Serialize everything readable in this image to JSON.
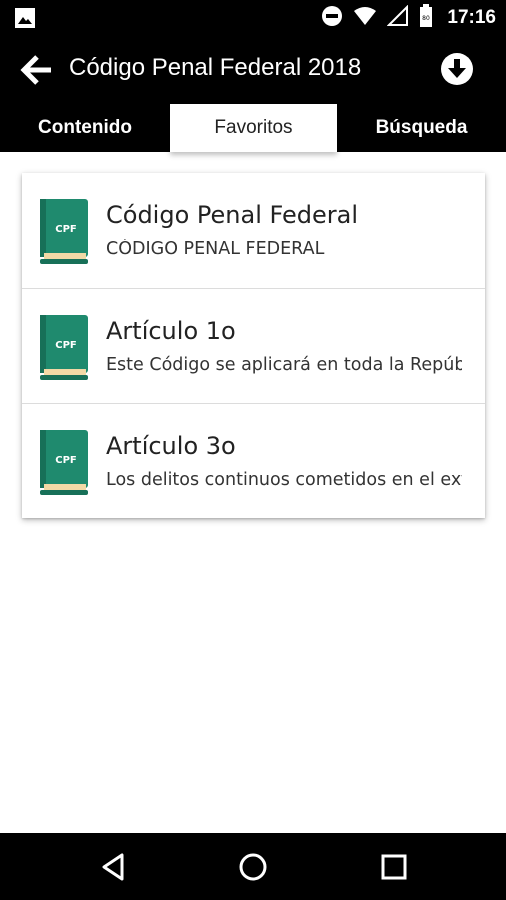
{
  "status_bar": {
    "time": "17:16",
    "icons": [
      "image-icon",
      "do-not-disturb-icon",
      "wifi-icon",
      "signal-icon",
      "battery-icon"
    ],
    "battery_label": "80"
  },
  "app_bar": {
    "title": "Código Penal Federal 2018",
    "back_icon": "arrow-left-icon",
    "download_icon": "download-circle-icon"
  },
  "tabs": [
    {
      "label": "Contenido",
      "active": false
    },
    {
      "label": "Favoritos",
      "active": true
    },
    {
      "label": "Búsqueda",
      "active": false
    }
  ],
  "favorites": [
    {
      "title": "Código Penal Federal",
      "subtitle": "CÓDIGO PENAL FEDERAL",
      "book_label": "CPF"
    },
    {
      "title": "Artículo 1o",
      "subtitle": "Este Código se aplicará en toda la República",
      "book_label": "CPF"
    },
    {
      "title": "Artículo 3o",
      "subtitle": "Los delitos continuos cometidos en el extranjero",
      "book_label": "CPF"
    }
  ],
  "nav_bar": {
    "icons": [
      "back-triangle-icon",
      "home-circle-icon",
      "recents-square-icon"
    ]
  },
  "colors": {
    "bar_background": "#000000",
    "book_green": "#1f8a6e",
    "book_pages": "#f2d9a6",
    "active_tab_background": "#ffffff"
  }
}
